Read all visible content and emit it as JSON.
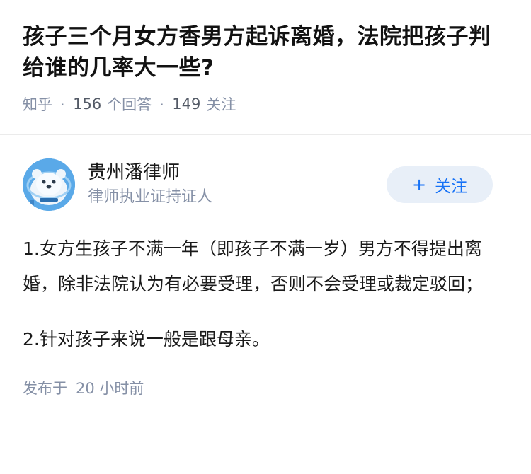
{
  "question": {
    "title": "孩子三个月女方香男方起诉离婚，法院把孩子判给谁的几率大一些?",
    "site": "知乎",
    "answer_count": "156",
    "answer_label": "个回答",
    "follower_count": "149",
    "follower_label": "关注"
  },
  "answer": {
    "author_name": "贵州潘律师",
    "author_badge": "律师执业证持证人",
    "follow_label": "关注",
    "follow_icon": "+",
    "paragraphs": [
      "1.女方生孩子不满一年（即孩子不满一岁）男方不得提出离婚，除非法院认为有必要受理，否则不会受理或裁定驳回；",
      "2.针对孩子来说一般是跟母亲。"
    ],
    "published_label": "发布于",
    "published_time": "20 小时前"
  },
  "colors": {
    "accent": "#1772f6",
    "follow_bg": "#e8eff8",
    "meta": "#8590a6"
  }
}
